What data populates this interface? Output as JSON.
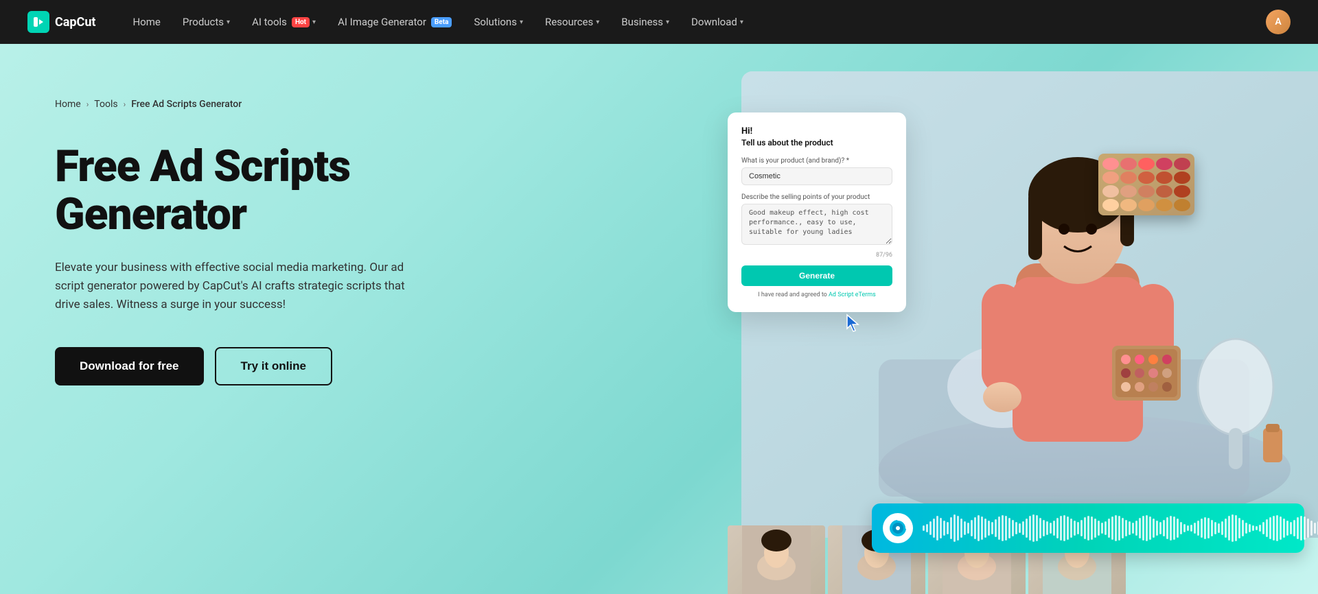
{
  "nav": {
    "logo_text": "CapCut",
    "items": [
      {
        "id": "home",
        "label": "Home",
        "has_dropdown": false
      },
      {
        "id": "products",
        "label": "Products",
        "has_dropdown": true
      },
      {
        "id": "ai-tools",
        "label": "AI tools",
        "has_dropdown": true,
        "badge": "Hot",
        "badge_type": "hot"
      },
      {
        "id": "ai-image",
        "label": "AI Image Generator",
        "has_dropdown": false,
        "badge": "Beta",
        "badge_type": "beta"
      },
      {
        "id": "solutions",
        "label": "Solutions",
        "has_dropdown": true
      },
      {
        "id": "resources",
        "label": "Resources",
        "has_dropdown": true
      },
      {
        "id": "business",
        "label": "Business",
        "has_dropdown": true
      },
      {
        "id": "download",
        "label": "Download",
        "has_dropdown": true
      }
    ]
  },
  "breadcrumb": {
    "home": "Home",
    "tools": "Tools",
    "current": "Free Ad Scripts Generator"
  },
  "hero": {
    "title": "Free Ad Scripts Generator",
    "description": "Elevate your business with effective social media marketing. Our ad script generator powered by CapCut's AI crafts strategic scripts that drive sales. Witness a surge in your success!",
    "btn_download": "Download for free",
    "btn_try": "Try it online"
  },
  "ai_form": {
    "greeting": "Hi!",
    "subtitle": "Tell us about the product",
    "label_product": "What is your product (and brand)? *",
    "input_product": "Cosmetic",
    "label_selling": "Describe the selling points of your product",
    "textarea_selling": "Good makeup effect, high cost performance., easy to use, suitable for young ladies",
    "char_count": "87/96",
    "generate_btn": "Generate",
    "terms_text": "I have read and agreed to ",
    "terms_link": "Ad Script eTerms"
  },
  "audio_bar": {
    "icon": "♪"
  },
  "waveform_heights": [
    8,
    12,
    20,
    28,
    36,
    30,
    22,
    18,
    32,
    40,
    36,
    28,
    20,
    16,
    24,
    32,
    38,
    34,
    28,
    22,
    18,
    26,
    34,
    38,
    36,
    30,
    24,
    18,
    14,
    20,
    28,
    36,
    40,
    38,
    30,
    24,
    20,
    16,
    22,
    30,
    36,
    38,
    34,
    28,
    22,
    18,
    24,
    32,
    36,
    34,
    28,
    22,
    16,
    20,
    28,
    34,
    38,
    36,
    30,
    24,
    20,
    16,
    22,
    30,
    36,
    38,
    34,
    28,
    22,
    18,
    24,
    32,
    36,
    34,
    28,
    18,
    12,
    8,
    10,
    16,
    22,
    28,
    32,
    30,
    24,
    18,
    14,
    20,
    28,
    36,
    40,
    38,
    30,
    24,
    16,
    12,
    8,
    6,
    10,
    18,
    26,
    32,
    36,
    38,
    34,
    28,
    22,
    18,
    24,
    32,
    36,
    34,
    28,
    22,
    16,
    20,
    28,
    34,
    38,
    36,
    30
  ]
}
